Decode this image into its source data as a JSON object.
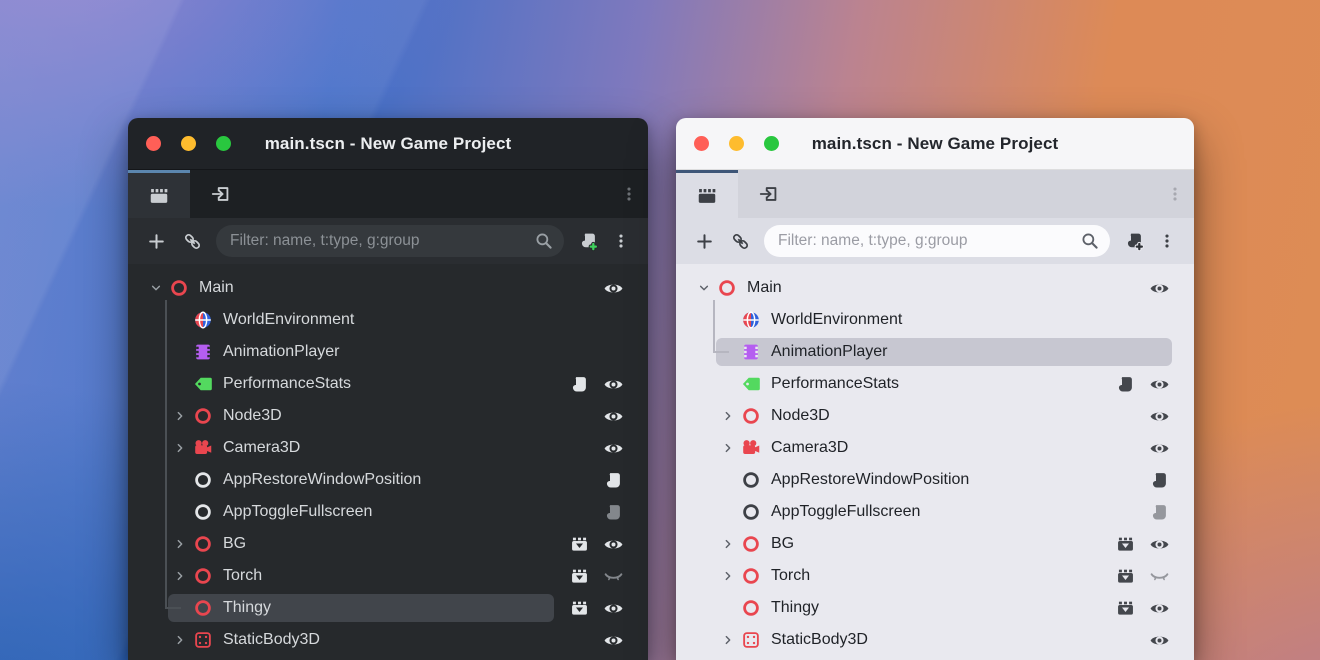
{
  "window_title": "main.tscn - New Game Project",
  "tabs": [
    {
      "icon": "clapper-tab",
      "name": "tab-scene",
      "active_in": "both"
    },
    {
      "icon": "import-tab",
      "name": "tab-import",
      "active_in": "none"
    }
  ],
  "toolbar": {
    "filter_placeholder": "Filter: name, t:type, g:group"
  },
  "tree": [
    {
      "label": "Main",
      "level": 0,
      "chevron": "down",
      "icon": "node3d",
      "buttons": [
        "eye"
      ]
    },
    {
      "label": "WorldEnvironment",
      "level": 1,
      "chevron": "none",
      "icon": "world",
      "buttons": []
    },
    {
      "label": "AnimationPlayer",
      "level": 1,
      "chevron": "none",
      "icon": "anim",
      "buttons": []
    },
    {
      "label": "PerformanceStats",
      "level": 1,
      "chevron": "none",
      "icon": "tag",
      "buttons": [
        "script",
        "eye"
      ]
    },
    {
      "label": "Node3D",
      "level": 1,
      "chevron": "right",
      "icon": "node3d",
      "buttons": [
        "eye"
      ]
    },
    {
      "label": "Camera3D",
      "level": 1,
      "chevron": "right",
      "icon": "camera",
      "buttons": [
        "eye"
      ]
    },
    {
      "label": "AppRestoreWindowPosition",
      "level": 1,
      "chevron": "none",
      "icon": "node",
      "buttons": [
        "script"
      ]
    },
    {
      "label": "AppToggleFullscreen",
      "level": 1,
      "chevron": "none",
      "icon": "node",
      "buttons": [
        "script-dim"
      ]
    },
    {
      "label": "BG",
      "level": 1,
      "chevron": "right",
      "icon": "node3d",
      "buttons": [
        "clapper",
        "eye"
      ]
    },
    {
      "label": "Torch",
      "level": 1,
      "chevron": "right",
      "icon": "node3d",
      "buttons": [
        "clapper",
        "eye-closed"
      ]
    },
    {
      "label": "Thingy",
      "level": 1,
      "chevron": "none",
      "icon": "node3d",
      "buttons": [
        "clapper",
        "eye"
      ]
    },
    {
      "label": "StaticBody3D",
      "level": 1,
      "chevron": "right",
      "icon": "staticbody",
      "buttons": [
        "eye"
      ]
    }
  ],
  "windows": [
    {
      "theme": "dark",
      "selected": "Thingy"
    },
    {
      "theme": "light",
      "selected": "AnimationPlayer"
    }
  ],
  "colors": {
    "node_red": "#e9464f",
    "animation_purple": "#b55ef0",
    "tag_green": "#53d95f",
    "world_blue": "#2f62dc",
    "traffic_red": "#ff5f57",
    "traffic_yellow": "#febc2e",
    "traffic_green": "#29c73f",
    "dark_tab_accent": "#5b86ae",
    "light_tab_accent": "#3e5678",
    "script_add_green": "#3ed25d"
  }
}
